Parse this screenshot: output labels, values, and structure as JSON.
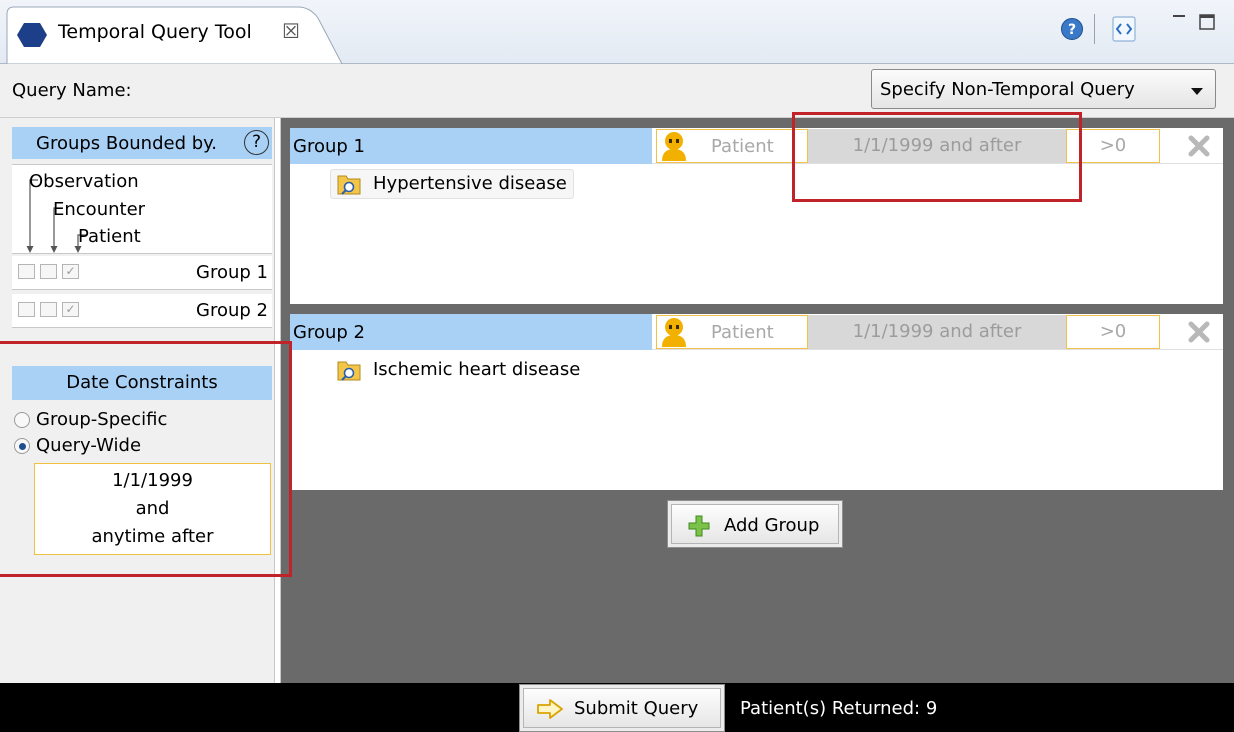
{
  "tab": {
    "title": "Temporal Query Tool",
    "close_glyph": "☒",
    "icons": [
      "hexagon-icon",
      "close-icon",
      "help-icon",
      "view-icon",
      "minimize-icon",
      "maximize-icon"
    ]
  },
  "query": {
    "name_label": "Query Name:",
    "type_selected": "Specify Non-Temporal Query"
  },
  "groups_bounded": {
    "header": "Groups Bounded by.",
    "help_glyph": "?",
    "tree": [
      "Observation",
      "Encounter",
      "Patient"
    ],
    "groups": [
      {
        "label": "Group 1",
        "observation": false,
        "encounter": false,
        "patient": true
      },
      {
        "label": "Group 2",
        "observation": false,
        "encounter": false,
        "patient": true
      }
    ]
  },
  "date_constraints": {
    "header": "Date Constraints",
    "options": [
      {
        "label": "Group-Specific",
        "selected": false
      },
      {
        "label": "Query-Wide",
        "selected": true
      }
    ],
    "range_lines": [
      "1/1/1999",
      "and",
      "anytime after"
    ]
  },
  "groups": [
    {
      "name": "Group 1",
      "scope": "Patient",
      "date": "1/1/1999 and after",
      "count": ">0",
      "concept": "Hypertensive disease"
    },
    {
      "name": "Group 2",
      "scope": "Patient",
      "date": "1/1/1999 and after",
      "count": ">0",
      "concept": "Ischemic heart disease"
    }
  ],
  "add_group_label": "Add Group",
  "footer": {
    "submit_label": "Submit Query",
    "returned_text": "Patient(s) Returned: 9"
  },
  "colors": {
    "header_blue": "#a9d0f5",
    "accent_yellow": "#f2c14a",
    "highlight_red": "#c0242a",
    "panel_gray": "#6a6a6a"
  }
}
